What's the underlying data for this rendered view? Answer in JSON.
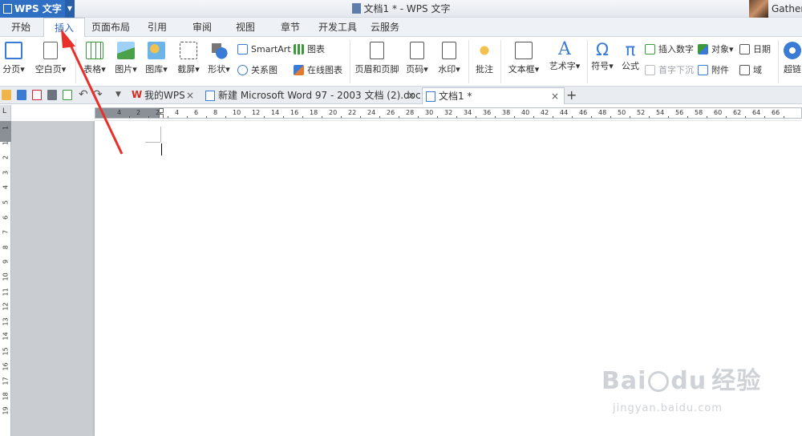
{
  "title_bar": {
    "app_name": "WPS 文字",
    "document_title": "文档1 * - WPS 文字",
    "user_name": "Gather"
  },
  "menu_tabs": [
    "开始",
    "插入",
    "页面布局",
    "引用",
    "审阅",
    "视图",
    "章节",
    "开发工具",
    "云服务"
  ],
  "active_menu_tab": "插入",
  "ribbon": {
    "page_break": "分页",
    "blank_page": "空白页",
    "table": "表格",
    "picture": "图片",
    "gallery": "图库",
    "screenshot": "截屏",
    "shapes": "形状",
    "smartart": "SmartArt",
    "chart": "图表",
    "relation": "关系图",
    "online_chart": "在线图表",
    "header_footer": "页眉和页脚",
    "page_number": "页码",
    "watermark": "水印",
    "comment": "批注",
    "textbox": "文本框",
    "wordart": "艺术字",
    "symbol": "符号",
    "formula": "公式",
    "insert_number": "插入数字",
    "dropcap": "首字下沉",
    "object": "对象",
    "attachment": "附件",
    "date": "日期",
    "field": "域",
    "hyperlink": "超链"
  },
  "doc_tabs": {
    "home": "我的WPS",
    "tab2": "新建 Microsoft Word 97 - 2003 文档 (2).doc",
    "tab3": "文档1 *",
    "close_glyph": "×",
    "add_glyph": "+"
  },
  "ruler": {
    "corner_label": "L",
    "h_ticks": [
      "4",
      "2",
      "2",
      "4",
      "6",
      "8",
      "10",
      "12",
      "14",
      "16",
      "18",
      "20",
      "22",
      "24",
      "26",
      "28",
      "30",
      "32",
      "34",
      "36",
      "38",
      "40",
      "42",
      "44",
      "46",
      "48",
      "50",
      "52",
      "54",
      "56",
      "58",
      "60",
      "62",
      "64",
      "66"
    ],
    "v_ticks": [
      "1",
      "1",
      "2",
      "3",
      "4",
      "5",
      "6",
      "7",
      "8",
      "9",
      "10",
      "11",
      "12",
      "13",
      "14",
      "15",
      "16",
      "17",
      "18",
      "19"
    ]
  },
  "watermark": {
    "brand": "Bai",
    "brand_suffix": "经验",
    "url": "jingyan.baidu.com"
  },
  "colors": {
    "accent": "#2f6fc4",
    "annotation_arrow": "#e8302a"
  }
}
